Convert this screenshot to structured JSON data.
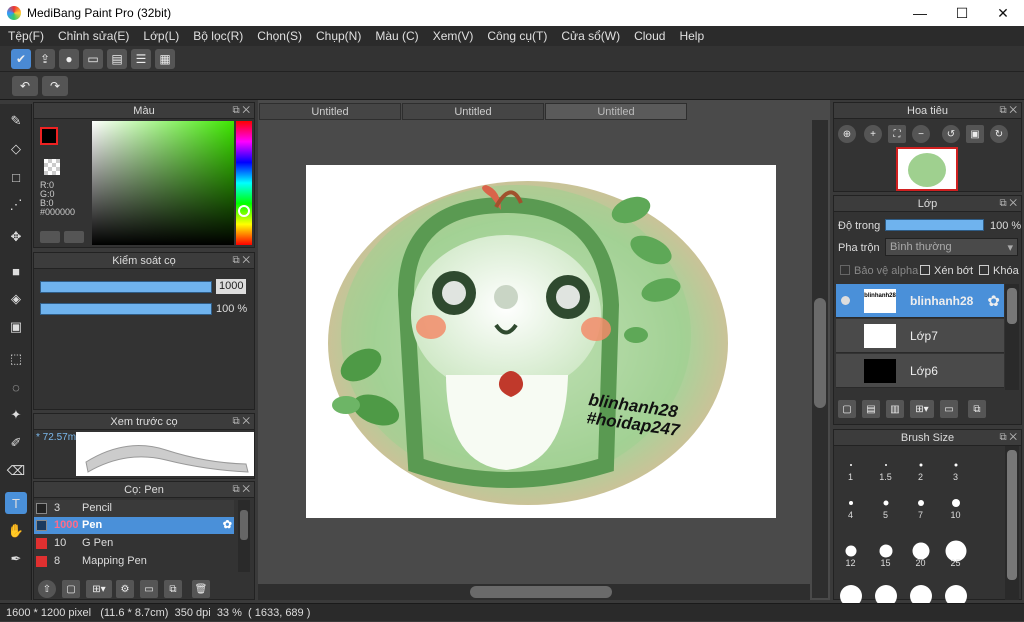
{
  "window": {
    "title": "MediBang Paint Pro (32bit)",
    "min": "—",
    "max": "☐",
    "close": "✕"
  },
  "menu": [
    "Tệp(F)",
    "Chỉnh sửa(E)",
    "Lớp(L)",
    "Bộ lọc(R)",
    "Chọn(S)",
    "Chụp(N)",
    "Màu (C)",
    "Xem(V)",
    "Công cụ(T)",
    "Cửa sổ(W)",
    "Cloud",
    "Help"
  ],
  "tabs": [
    "Untitled",
    "Untitled",
    "Untitled"
  ],
  "color_panel": {
    "title": "Màu",
    "r": "R:0",
    "g": "G:0",
    "b": "B:0",
    "hex": "#000000"
  },
  "brush_control": {
    "title": "Kiểm soát cọ",
    "size": "1000",
    "opacity": "100 %"
  },
  "brush_preview": {
    "title": "Xem trước cọ",
    "zoom": "* 72.57m"
  },
  "pen_panel": {
    "title": "Cọ: Pen",
    "items": [
      {
        "size": "3",
        "name": "Pencil",
        "color": "#222222"
      },
      {
        "size": "1000",
        "name": "Pen",
        "color": "#1a3a5e"
      },
      {
        "size": "10",
        "name": "G Pen",
        "color": "#e03030"
      },
      {
        "size": "8",
        "name": "Mapping Pen",
        "color": "#e03030"
      }
    ]
  },
  "navigator": {
    "title": "Hoa tiêu"
  },
  "layer_panel": {
    "title": "Lớp",
    "opacity_label": "Độ trong",
    "opacity_value": "100 %",
    "blend_label": "Pha trộn",
    "blend_value": "Bình thường",
    "protect_alpha": "Bảo vệ alpha",
    "clipping": "Xén bớt",
    "lock": "Khóa",
    "layers": [
      {
        "name": "blinhanh28",
        "thumb_text": "blinhanh28"
      },
      {
        "name": "Lớp7"
      },
      {
        "name": "Lớp6"
      }
    ]
  },
  "brush_size_panel": {
    "title": "Brush Size",
    "sizes": [
      "1",
      "1.5",
      "2",
      "3",
      "4",
      "5",
      "7",
      "10",
      "12",
      "15",
      "20",
      "25"
    ]
  },
  "artwork": {
    "text1": "blinhanh28",
    "text2": "#hoidap247"
  },
  "status": {
    "dims": "1600 * 1200 pixel",
    "cm": "(11.6 * 8.7cm)",
    "dpi": "350 dpi",
    "zoom": "33 %",
    "coord": "( 1633, 689 )"
  },
  "colors": {
    "accent": "#4a90d9",
    "panel": "#333333",
    "slider": "#6fb3ee"
  }
}
